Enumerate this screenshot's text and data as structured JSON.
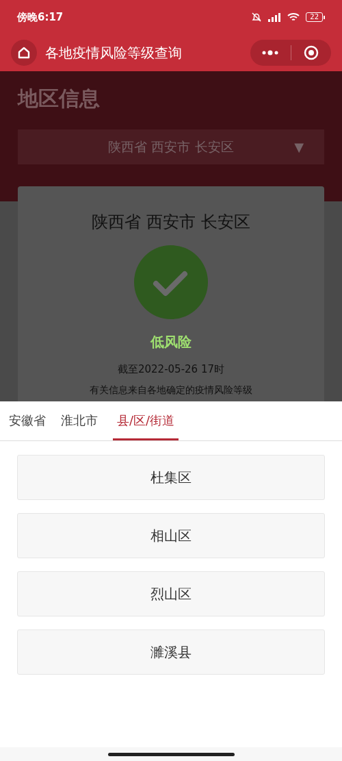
{
  "status_bar": {
    "time": "傍晚6:17",
    "battery": "22"
  },
  "nav": {
    "title": "各地疫情风险等级查询"
  },
  "region_section": {
    "heading": "地区信息",
    "dropdown": {
      "value": "陕西省 西安市 长安区",
      "symbol": "▼"
    }
  },
  "result_card": {
    "location": "陕西省 西安市 长安区",
    "risk": {
      "kind": "low",
      "label": "低风险"
    },
    "updated": "截至2022-05-26 17时",
    "note": "有关信息来自各地确定的疫情风险等级"
  },
  "picker": {
    "tabs": [
      {
        "label": "安徽省",
        "selected": false
      },
      {
        "label": "淮北市",
        "selected": false
      },
      {
        "label": "县/区/街道",
        "selected": true
      }
    ],
    "options": [
      "杜集区",
      "相山区",
      "烈山区",
      "濉溪县"
    ]
  }
}
